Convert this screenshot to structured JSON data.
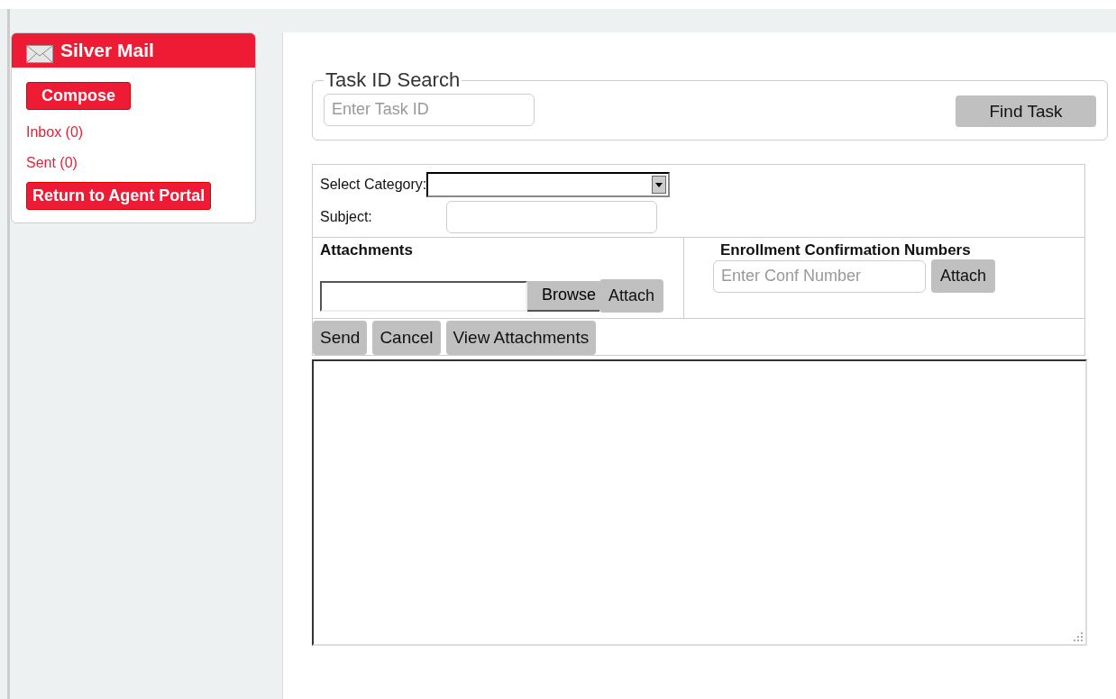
{
  "sidebar": {
    "title": "Silver Mail",
    "compose": "Compose",
    "links": [
      {
        "label": "Inbox (0)"
      },
      {
        "label": "Sent (0)"
      }
    ],
    "return_button": "Return to Agent Portal"
  },
  "task_search": {
    "legend": "Task ID Search",
    "placeholder": "Enter Task ID",
    "button": "Find Task"
  },
  "form": {
    "category_label": "Select Category:",
    "subject_label": "Subject:",
    "attachments": {
      "heading": "Attachments",
      "browse": "Browse",
      "attach": "Attach"
    },
    "enrollment": {
      "heading": "Enrollment Confirmation Numbers",
      "placeholder": "Enter Conf Number",
      "attach": "Attach"
    },
    "actions": [
      "Send",
      "Cancel",
      "View Attachments"
    ]
  }
}
